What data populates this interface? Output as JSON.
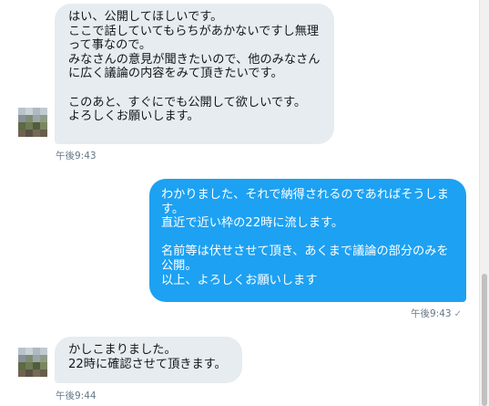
{
  "messages": [
    {
      "direction": "in",
      "text": "はい、公開してほしいです。\nここで話していてもらちがあかないですし無理って事なので。\nみなさんの意見が聞きたいので、他のみなさんに広く議論の内容をみて頂きたいです。\n\nこのあと、すぐにでも公開して欲しいです。\nよろしくお願いします。",
      "time": "午後9:43"
    },
    {
      "direction": "out",
      "text": "わかりました、それで納得されるのであればそうします。\n直近で近い枠の22時に流します。\n\n名前等は伏せさせて頂き、あくまで議論の部分のみを公開。\n以上、よろしくお願いします",
      "time": "午後9:43",
      "read_mark": "✓"
    },
    {
      "direction": "in",
      "text": "かしこまりました。\n22時に確認させて頂きます。",
      "time": "午後9:44"
    }
  ],
  "colors": {
    "incoming_bubble": "#e6ecf0",
    "outgoing_bubble": "#1da1f2",
    "timestamp": "#657786"
  },
  "icons": {
    "avatar": "pixelated-avatar",
    "read": "check-icon"
  }
}
